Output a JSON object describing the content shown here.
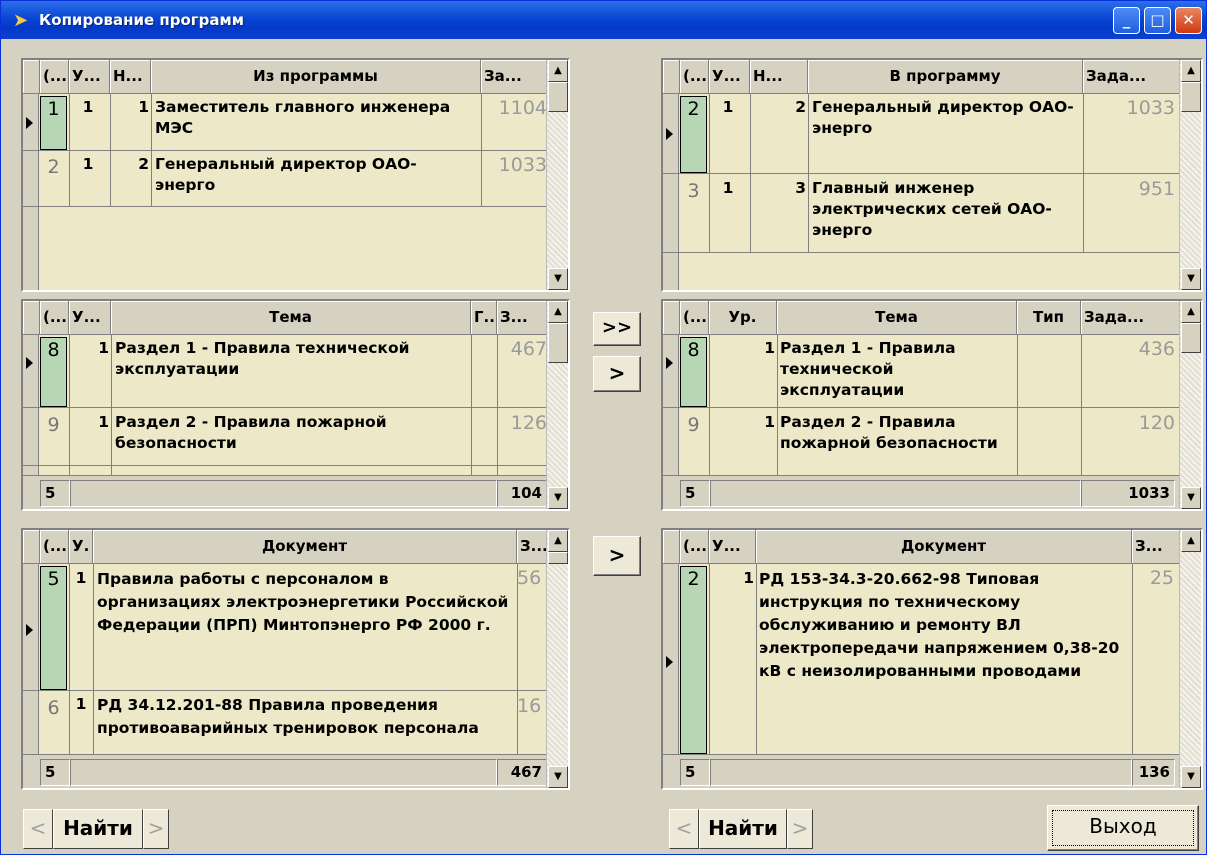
{
  "window": {
    "title": "Копирование программ",
    "icon": "folder-arrow-icon",
    "buttons": {
      "min": "_",
      "max": "□",
      "close": "✕"
    }
  },
  "from_program": {
    "headers": [
      "(...",
      "У...",
      "Н...",
      "Из программы",
      "За..."
    ],
    "rows": [
      {
        "id": "1",
        "u": "1",
        "n": "1",
        "text": "Заместитель главного инженера  МЭС",
        "value": "1104"
      },
      {
        "id": "2",
        "u": "1",
        "n": "2",
        "text": "Генеральный директор ОАО-энерго",
        "value": "1033"
      }
    ]
  },
  "to_program": {
    "headers": [
      "(...",
      "У...",
      "Н...",
      "В программу",
      "Зада..."
    ],
    "rows": [
      {
        "id": "2",
        "u": "1",
        "n": "2",
        "text": "Генеральный директор ОАО-энерго",
        "value": "1033"
      },
      {
        "id": "3",
        "u": "1",
        "n": "3",
        "text": "Главный инженер электрических сетей ОАО-энерго",
        "value": "951"
      }
    ]
  },
  "from_topics": {
    "headers": [
      "(...",
      "У...",
      "Тема",
      "Г...",
      "З..."
    ],
    "rows": [
      {
        "id": "8",
        "u": "1",
        "text": "Раздел 1 - Правила технической эксплуатации",
        "value": "467"
      },
      {
        "id": "9",
        "u": "1",
        "text": "Раздел 2 - Правила пожарной безопасности",
        "value": "126"
      }
    ],
    "footer_count": "5",
    "footer_total": "104"
  },
  "to_topics": {
    "headers": [
      "(...",
      "Ур.",
      "Тема",
      "Тип",
      "Зада..."
    ],
    "rows": [
      {
        "id": "8",
        "u": "1",
        "text": "Раздел 1 - Правила технической эксплуатации",
        "value": "436"
      },
      {
        "id": "9",
        "u": "1",
        "text": "Раздел 2 - Правила пожарной безопасности",
        "value": "120"
      }
    ],
    "footer_count": "5",
    "footer_total": "1033"
  },
  "from_docs": {
    "headers": [
      "(...",
      "У.",
      "Документ",
      "З..."
    ],
    "rows": [
      {
        "id": "5",
        "u": "1",
        "text": "Правила  работы с персоналом  в организациях электроэнергетики Российской Федерации (ПРП) Минтопэнерго РФ 2000 г.",
        "value": "56"
      },
      {
        "id": "6",
        "u": "1",
        "text": "РД 34.12.201-88 Правила проведения противоаварийных тренировок персонала",
        "value": "16"
      }
    ],
    "footer_count": "5",
    "footer_total": "467"
  },
  "to_docs": {
    "headers": [
      "(...",
      "У...",
      "Документ",
      "З..."
    ],
    "rows": [
      {
        "id": "2",
        "u": "1",
        "text": "РД 153-34.3-20.662-98 Типовая инструкция по техническому обслуживанию и  ремонту ВЛ электропередачи напряжением 0,38-20 кВ с неизолированными проводами",
        "value": "25"
      }
    ],
    "footer_count": "5",
    "footer_total": "136"
  },
  "buttons": {
    "copy_all": ">>",
    "copy_one": ">",
    "copy_doc": ">",
    "find": "Найти",
    "prev": "<",
    "next": ">",
    "exit": "Выход"
  }
}
